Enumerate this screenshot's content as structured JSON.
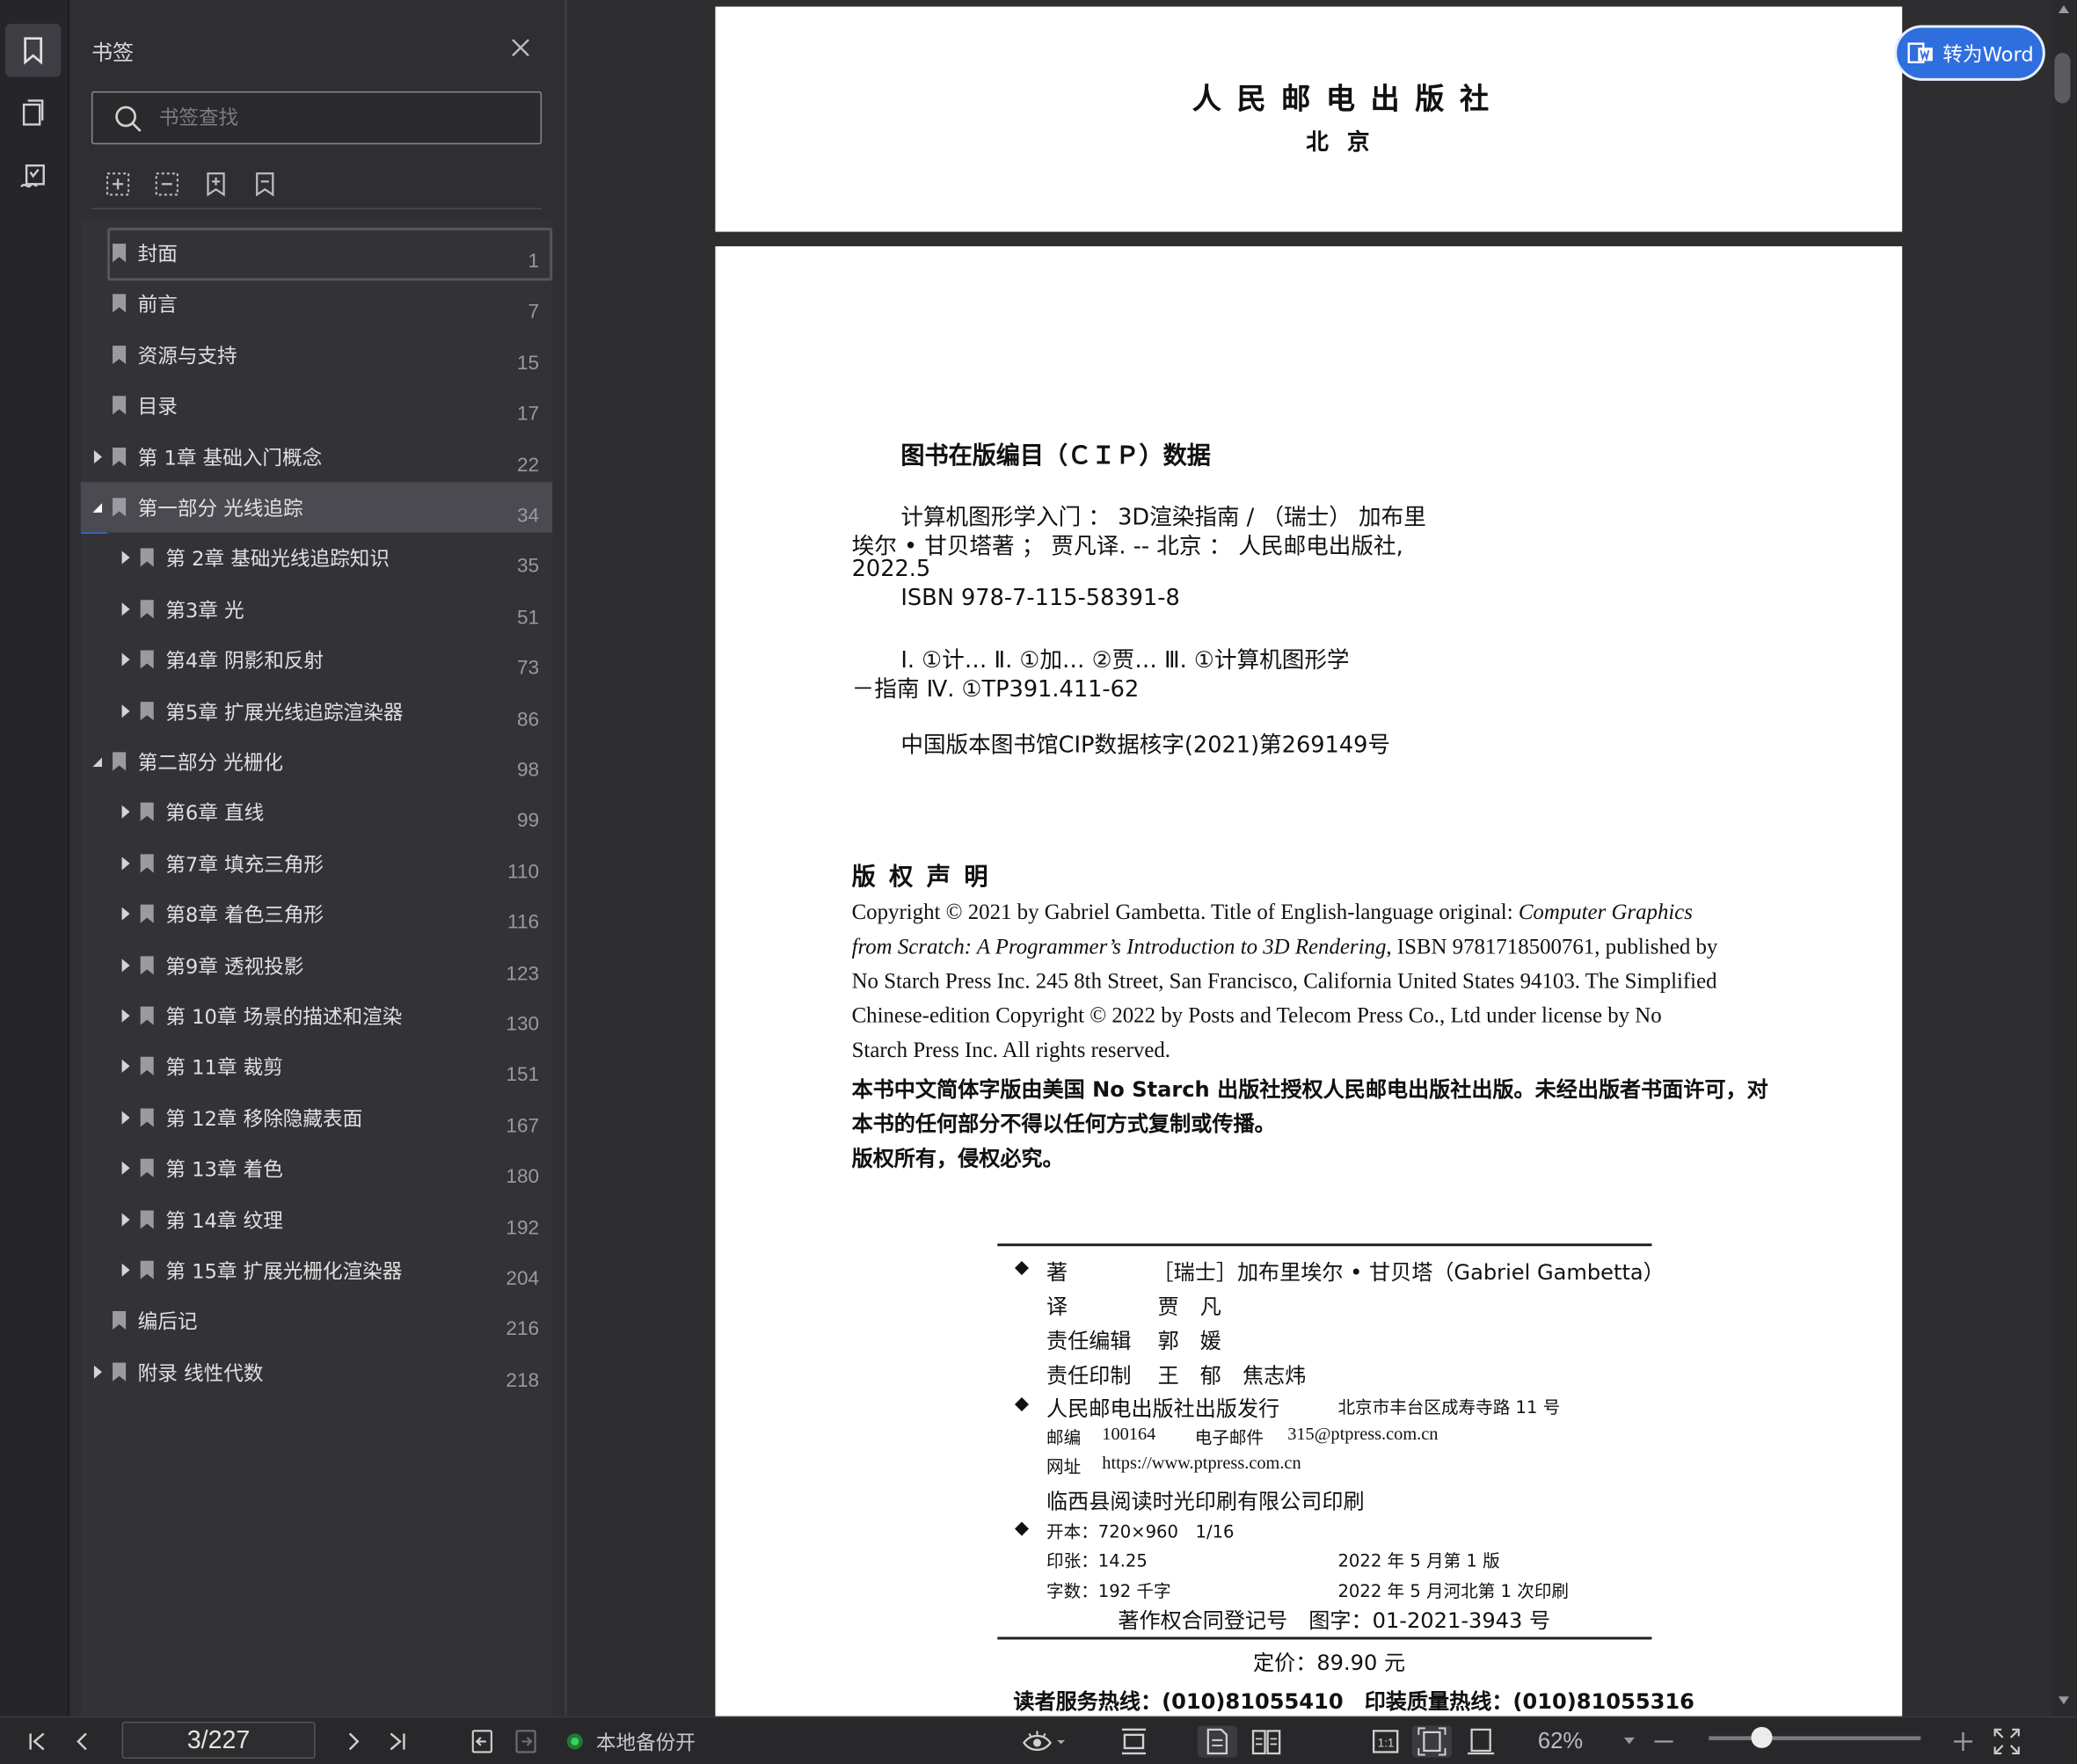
{
  "sidebar": {
    "title": "书签",
    "search_placeholder": "书签查找",
    "bookmarks": [
      {
        "label": "封面",
        "page": "1"
      },
      {
        "label": "前言",
        "page": "7"
      },
      {
        "label": "资源与支持",
        "page": "15"
      },
      {
        "label": "目录",
        "page": "17"
      },
      {
        "label": "第 1章 基础入门概念",
        "page": "22"
      },
      {
        "label": "第一部分 光线追踪",
        "page": "34"
      },
      {
        "label": "第 2章 基础光线追踪知识",
        "page": "35"
      },
      {
        "label": "第3章 光",
        "page": "51"
      },
      {
        "label": "第4章 阴影和反射",
        "page": "73"
      },
      {
        "label": "第5章 扩展光线追踪渲染器",
        "page": "86"
      },
      {
        "label": "第二部分 光栅化",
        "page": "98"
      },
      {
        "label": "第6章 直线",
        "page": "99"
      },
      {
        "label": "第7章 填充三角形",
        "page": "110"
      },
      {
        "label": "第8章 着色三角形",
        "page": "116"
      },
      {
        "label": "第9章 透视投影",
        "page": "123"
      },
      {
        "label": "第 10章 场景的描述和渲染",
        "page": "130"
      },
      {
        "label": "第 11章 裁剪",
        "page": "151"
      },
      {
        "label": "第 12章 移除隐藏表面",
        "page": "167"
      },
      {
        "label": "第 13章 着色",
        "page": "180"
      },
      {
        "label": "第 14章 纹理",
        "page": "192"
      },
      {
        "label": "第 15章 扩展光栅化渲染器",
        "page": "204"
      },
      {
        "label": "编后记",
        "page": "216"
      },
      {
        "label": "附录 线性代数",
        "page": "218"
      }
    ]
  },
  "toolbar": {
    "convert_word_label": "转为Word"
  },
  "document": {
    "page1": {
      "publisher": "人 民 邮 电 出 版 社",
      "city": "北 京"
    },
    "cip": {
      "heading": "图书在版编目（ＣＩＰ）数据",
      "line1": "计算机图形学入门 ： 3D渲染指南 / （瑞士） 加布里",
      "line2": "埃尔 • 甘贝塔著 ； 贾凡译. -- 北京 ： 人民邮电出版社,",
      "line3": "2022.5",
      "line4": "ISBN 978-7-115-58391-8",
      "line5": "Ⅰ. ①计… Ⅱ. ①加… ②贾… Ⅲ. ①计算机图形学",
      "line6": "－指南 Ⅳ. ①TP391.411-62",
      "line7": "中国版本图书馆CIP数据核字(2021)第269149号"
    },
    "copyright": {
      "heading": "版 权 声 明",
      "en_line1": "Copyright © 2021 by Gabriel Gambetta. Title of English-language original: ",
      "en_title1": "Computer Graphics",
      "en_title2": "from Scratch: A Programmer’s Introduction to 3D Rendering",
      "en_line2_rest": ", ISBN 9781718500761, published by",
      "en_line3": "No Starch Press Inc. 245 8th Street, San Francisco, California United States 94103. The Simplified",
      "en_line4": "Chinese-edition Copyright © 2022 by Posts and Telecom Press Co., Ltd under license by No",
      "en_line5": "Starch Press Inc. All rights reserved.",
      "cn_line1": "本书中文简体字版由美国 No Starch 出版社授权人民邮电出版社出版。未经出版者书面许可，对",
      "cn_line2": "本书的任何部分不得以任何方式复制或传播。",
      "cn_line3": "版权所有，侵权必究。"
    },
    "colophon": {
      "bullet": "◆",
      "author_role": "著",
      "author": "［瑞士］加布里埃尔 • 甘贝塔（Gabriel Gambetta）",
      "translator_role": "译",
      "translator": "贾　凡",
      "editor_role": "责任编辑",
      "editor": "郭　媛",
      "print_role": "责任印制",
      "printer": "王　郁　焦志炜",
      "publisher": "人民邮电出版社出版发行",
      "address": "北京市丰台区成寿寺路 11 号",
      "postcode_label": "邮编",
      "postcode": "100164",
      "email_label": "电子邮件",
      "email": "315@ptpress.com.cn",
      "website_label": "网址",
      "website": "https://www.ptpress.com.cn",
      "print_house": "临西县阅读时光印刷有限公司印刷",
      "format": "开本：720×960　1/16",
      "sheets": "印张：14.25",
      "edition": "2022 年 5 月第 1 版",
      "words": "字数：192 千字",
      "printing": "2022 年 5 月河北第 1 次印刷",
      "contract": "著作权合同登记号　图字：01-2021-3943 号",
      "price": "定价：89.90 元",
      "hotline": "读者服务热线：(010)81055410　印装质量热线：(010)81055316"
    }
  },
  "statusbar": {
    "page_indicator": "3/227",
    "backup_status": "本地备份开",
    "zoom": "62%",
    "zoom_slider_fraction": 0.25
  },
  "colors": {
    "accent": "#2a6fe0",
    "backup_dot": "#2fb54a"
  }
}
